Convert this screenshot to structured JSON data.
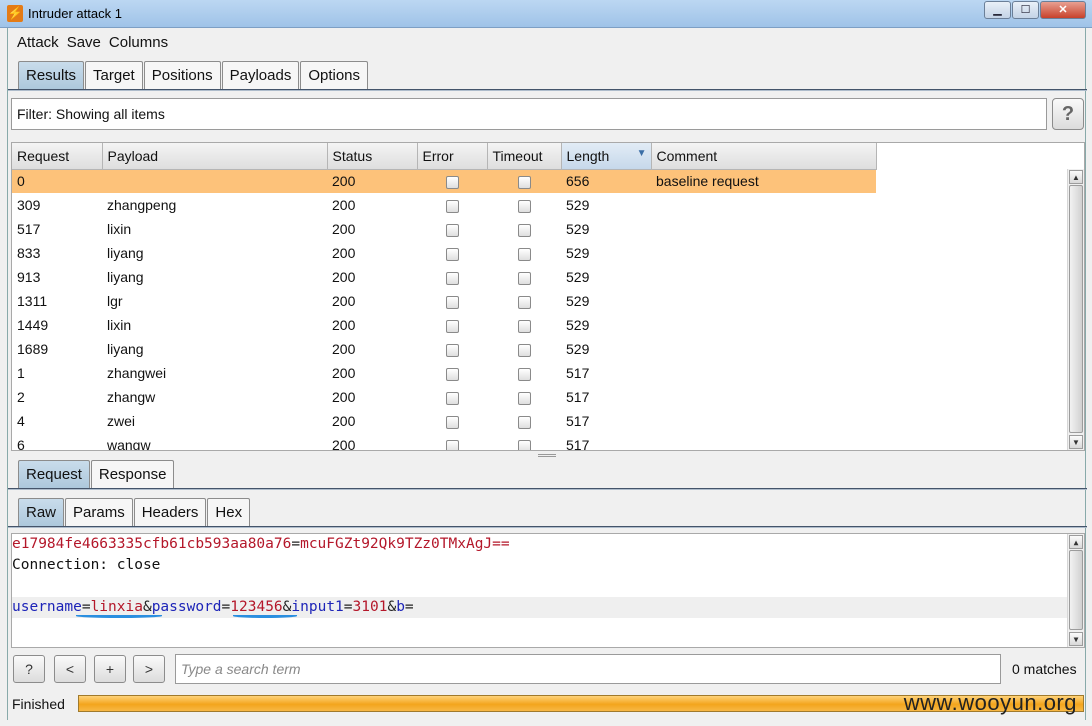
{
  "window": {
    "title": "Intruder attack 1",
    "app_icon": "burp-icon",
    "min_glyph": "▁",
    "max_glyph": "☐",
    "close_glyph": "✕"
  },
  "menu": [
    "Attack",
    "Save",
    "Columns"
  ],
  "main_tabs": [
    "Results",
    "Target",
    "Positions",
    "Payloads",
    "Options"
  ],
  "filter": {
    "text": "Filter: Showing all items",
    "help_glyph": "?"
  },
  "table": {
    "columns": [
      "Request",
      "Payload",
      "Status",
      "Error",
      "Timeout",
      "Length",
      "Comment"
    ],
    "sorted_column": "Length",
    "rows": [
      {
        "request": "0",
        "payload": "",
        "status": "200",
        "length": "656",
        "comment": "baseline request"
      },
      {
        "request": "309",
        "payload": "zhangpeng",
        "status": "200",
        "length": "529",
        "comment": ""
      },
      {
        "request": "517",
        "payload": "lixin",
        "status": "200",
        "length": "529",
        "comment": ""
      },
      {
        "request": "833",
        "payload": "liyang",
        "status": "200",
        "length": "529",
        "comment": ""
      },
      {
        "request": "913",
        "payload": "liyang",
        "status": "200",
        "length": "529",
        "comment": ""
      },
      {
        "request": "1311",
        "payload": "lgr",
        "status": "200",
        "length": "529",
        "comment": ""
      },
      {
        "request": "1449",
        "payload": "lixin",
        "status": "200",
        "length": "529",
        "comment": ""
      },
      {
        "request": "1689",
        "payload": "liyang",
        "status": "200",
        "length": "529",
        "comment": ""
      },
      {
        "request": "1",
        "payload": "zhangwei",
        "status": "200",
        "length": "517",
        "comment": ""
      },
      {
        "request": "2",
        "payload": "zhangw",
        "status": "200",
        "length": "517",
        "comment": ""
      },
      {
        "request": "4",
        "payload": "zwei",
        "status": "200",
        "length": "517",
        "comment": ""
      },
      {
        "request": "6",
        "payload": "wangw",
        "status": "200",
        "length": "517",
        "comment": ""
      }
    ]
  },
  "detail_tabs": [
    "Request",
    "Response"
  ],
  "view_tabs": [
    "Raw",
    "Params",
    "Headers",
    "Hex"
  ],
  "editor": {
    "cookie_key": "e17984fe4663335cfb61cb593aa80a76",
    "cookie_value": "mcuFGZt92Qk9TZz0TMxAgJ==",
    "connection": "Connection: close",
    "params": [
      {
        "key": "username",
        "value": "linxia"
      },
      {
        "key": "password",
        "value": "123456"
      },
      {
        "key": "input1",
        "value": "3101"
      },
      {
        "key": "b",
        "value": ""
      }
    ]
  },
  "search": {
    "help": "?",
    "prev": "<",
    "add": "+",
    "next": ">",
    "placeholder": "Type a search term",
    "matches": "0 matches"
  },
  "status": {
    "text": "Finished",
    "progress": 1.0,
    "watermark": "www.wooyun.org"
  },
  "colors": {
    "selected_row": "#fdc27a",
    "progress": "#f3a51d",
    "param_key": "#1d24b8",
    "param_value": "#b4172a"
  }
}
